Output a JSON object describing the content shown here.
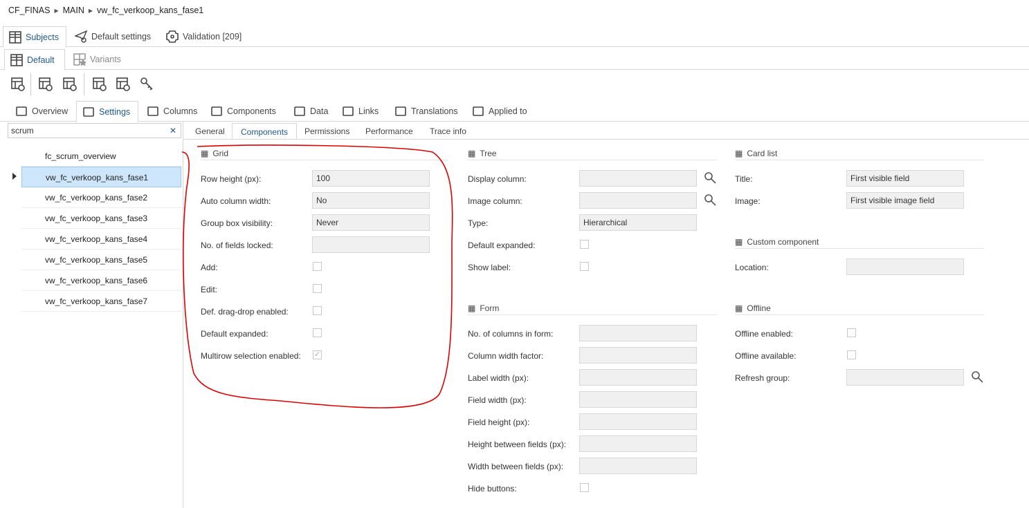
{
  "breadcrumb": [
    "CF_FINAS",
    "MAIN",
    "vw_fc_verkoop_kans_fase1"
  ],
  "top_tabs": [
    {
      "label": "Subjects",
      "icon": "grid-icon"
    },
    {
      "label": "Default settings",
      "icon": "send-gear-icon"
    },
    {
      "label": "Validation [209]",
      "icon": "validation-icon"
    }
  ],
  "second_tabs": [
    {
      "label": "Default",
      "icon": "grid-icon"
    },
    {
      "label": "Variants",
      "icon": "grid-star-icon"
    }
  ],
  "toolbar": [
    "add-variant-icon",
    "grid-edit-icon",
    "form-edit-icon",
    "view-search-icon",
    "code-search-icon",
    "key-icon"
  ],
  "main_tabs": [
    {
      "label": "Overview",
      "icon": "folder-icon"
    },
    {
      "label": "Settings",
      "icon": "sliders-icon"
    },
    {
      "label": "Columns",
      "icon": "column-icon"
    },
    {
      "label": "Components",
      "icon": "component-icon"
    },
    {
      "label": "Data",
      "icon": "data-icon"
    },
    {
      "label": "Links",
      "icon": "link-icon"
    },
    {
      "label": "Translations",
      "icon": "translate-icon"
    },
    {
      "label": "Applied to",
      "icon": "location-icon"
    }
  ],
  "search": {
    "value": "scrum"
  },
  "list": [
    "fc_scrum_overview",
    "vw_fc_verkoop_kans_fase1",
    "vw_fc_verkoop_kans_fase2",
    "vw_fc_verkoop_kans_fase3",
    "vw_fc_verkoop_kans_fase4",
    "vw_fc_verkoop_kans_fase5",
    "vw_fc_verkoop_kans_fase6",
    "vw_fc_verkoop_kans_fase7"
  ],
  "sub_tabs": [
    "General",
    "Components",
    "Permissions",
    "Performance",
    "Trace info"
  ],
  "grid": {
    "title": "Grid",
    "fields": [
      {
        "label": "Row height (px):",
        "type": "input",
        "value": "100"
      },
      {
        "label": "Auto column width:",
        "type": "input",
        "value": "No"
      },
      {
        "label": "Group box visibility:",
        "type": "input",
        "value": "Never"
      },
      {
        "label": "No. of fields locked:",
        "type": "input",
        "value": ""
      },
      {
        "label": "Add:",
        "type": "check",
        "checked": false
      },
      {
        "label": "Edit:",
        "type": "check",
        "checked": false
      },
      {
        "label": "Def. drag-drop enabled:",
        "type": "check",
        "checked": false
      },
      {
        "label": "Default expanded:",
        "type": "check",
        "checked": false
      },
      {
        "label": "Multirow selection enabled:",
        "type": "check",
        "checked": true
      }
    ]
  },
  "tree": {
    "title": "Tree",
    "fields": [
      {
        "label": "Display column:",
        "type": "input",
        "value": "",
        "search": true
      },
      {
        "label": "Image column:",
        "type": "input",
        "value": "",
        "search": true
      },
      {
        "label": "Type:",
        "type": "input",
        "value": "Hierarchical"
      },
      {
        "label": "Default expanded:",
        "type": "check",
        "checked": false
      },
      {
        "label": "Show label:",
        "type": "check",
        "checked": false
      }
    ]
  },
  "form": {
    "title": "Form",
    "fields": [
      {
        "label": "No. of columns in form:",
        "type": "input",
        "value": ""
      },
      {
        "label": "Column width factor:",
        "type": "input",
        "value": ""
      },
      {
        "label": "Label width (px):",
        "type": "input",
        "value": ""
      },
      {
        "label": "Field width (px):",
        "type": "input",
        "value": ""
      },
      {
        "label": "Field height (px):",
        "type": "input",
        "value": ""
      },
      {
        "label": "Height between fields (px):",
        "type": "input",
        "value": ""
      },
      {
        "label": "Width between fields (px):",
        "type": "input",
        "value": ""
      },
      {
        "label": "Hide buttons:",
        "type": "check",
        "checked": false
      }
    ]
  },
  "card_list": {
    "title": "Card list",
    "fields": [
      {
        "label": "Title:",
        "type": "input",
        "value": "First visible field"
      },
      {
        "label": "Image:",
        "type": "input",
        "value": "First visible image field"
      }
    ]
  },
  "custom_component": {
    "title": "Custom component",
    "fields": [
      {
        "label": "Location:",
        "type": "input",
        "value": ""
      }
    ]
  },
  "offline": {
    "title": "Offline",
    "fields": [
      {
        "label": "Offline enabled:",
        "type": "check",
        "checked": false
      },
      {
        "label": "Offline available:",
        "type": "check",
        "checked": false
      },
      {
        "label": "Refresh group:",
        "type": "input",
        "value": "",
        "search": true
      }
    ]
  },
  "colors": {
    "accent": "#1e5a8c",
    "selected": "#cde6fb",
    "annotation": "#e00000"
  }
}
